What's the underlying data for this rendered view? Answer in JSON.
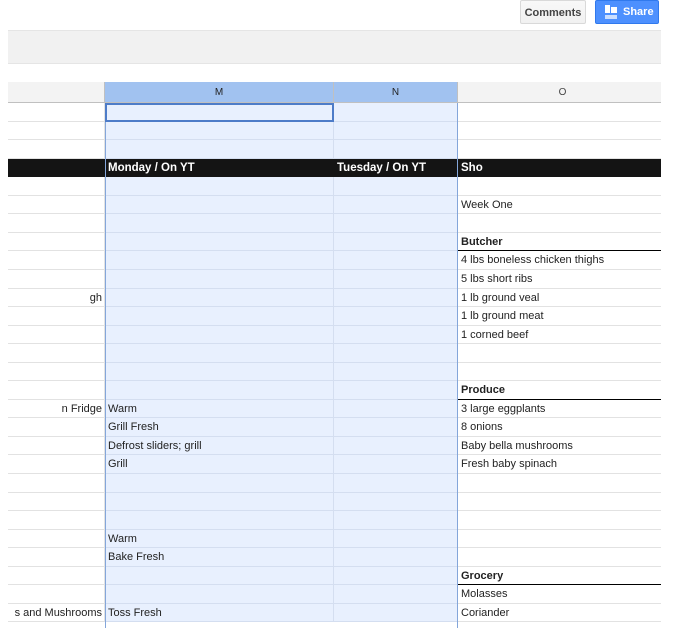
{
  "header": {
    "comments_label": "Comments",
    "share_label": "Share"
  },
  "columns": [
    {
      "label": "",
      "selected": false
    },
    {
      "label": "M",
      "selected": true
    },
    {
      "label": "N",
      "selected": true
    },
    {
      "label": "O",
      "selected": false
    }
  ],
  "rows": [
    {
      "l": "",
      "m": "",
      "n": "",
      "o": ""
    },
    {
      "l": "",
      "m": "",
      "n": "",
      "o": ""
    },
    {
      "l": "",
      "m": "",
      "n": "",
      "o": ""
    },
    {
      "l": "",
      "m": "Monday / On YT",
      "n": "Tuesday / On YT",
      "o": "Sho",
      "style": "dark"
    },
    {
      "l": "",
      "m": "",
      "n": "",
      "o": ""
    },
    {
      "l": "",
      "m": "",
      "n": "",
      "o": "Week One"
    },
    {
      "l": "",
      "m": "",
      "n": "",
      "o": ""
    },
    {
      "l": "",
      "m": "",
      "n": "",
      "o": "Butcher",
      "o_style": "bold underline"
    },
    {
      "l": "",
      "m": "",
      "n": "",
      "o": "4 lbs boneless chicken thighs"
    },
    {
      "l": "",
      "m": "",
      "n": "",
      "o": "5 lbs short ribs"
    },
    {
      "l": "gh",
      "m": "",
      "n": "",
      "o": "1 lb ground veal"
    },
    {
      "l": "",
      "m": "",
      "n": "",
      "o": "1 lb ground meat"
    },
    {
      "l": "",
      "m": "",
      "n": "",
      "o": "1 corned beef"
    },
    {
      "l": "",
      "m": "",
      "n": "",
      "o": ""
    },
    {
      "l": "",
      "m": "",
      "n": "",
      "o": ""
    },
    {
      "l": "",
      "m": "",
      "n": "",
      "o": "Produce",
      "o_style": "bold underline"
    },
    {
      "l": "n Fridge",
      "m": "Warm",
      "n": "",
      "o": "3 large eggplants"
    },
    {
      "l": "",
      "m": "Grill Fresh",
      "n": "",
      "o": "8 onions"
    },
    {
      "l": "",
      "m": "Defrost sliders; grill",
      "n": "",
      "o": "Baby bella mushrooms"
    },
    {
      "l": "",
      "m": "Grill",
      "n": "",
      "o": "Fresh baby spinach"
    },
    {
      "l": "",
      "m": "",
      "n": "",
      "o": ""
    },
    {
      "l": "",
      "m": "",
      "n": "",
      "o": ""
    },
    {
      "l": "",
      "m": "",
      "n": "",
      "o": ""
    },
    {
      "l": "",
      "m": "Warm",
      "n": "",
      "o": ""
    },
    {
      "l": "",
      "m": "Bake Fresh",
      "n": "",
      "o": ""
    },
    {
      "l": "",
      "m": "",
      "n": "",
      "o": "Grocery",
      "o_style": "bold underline"
    },
    {
      "l": "",
      "m": "",
      "n": "",
      "o": "Molasses"
    },
    {
      "l": "s and Mushrooms",
      "m": "Toss Fresh",
      "n": "",
      "o": "Coriander"
    }
  ]
}
